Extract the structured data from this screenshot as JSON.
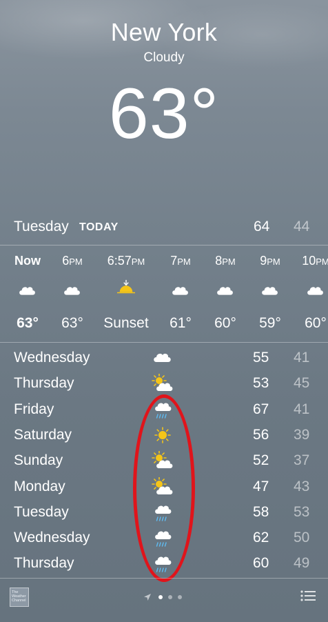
{
  "location": {
    "city": "New York",
    "condition": "Cloudy",
    "temperature": "63°"
  },
  "today": {
    "day": "Tuesday",
    "tag": "TODAY",
    "high": "64",
    "low": "44"
  },
  "hourly": [
    {
      "time": "Now",
      "time_suffix": "",
      "icon": "cloud-icon",
      "temp": "63°"
    },
    {
      "time": "6",
      "time_suffix": "PM",
      "icon": "cloud-icon",
      "temp": "63°"
    },
    {
      "time": "6:57",
      "time_suffix": "PM",
      "icon": "sunset-icon",
      "temp": "Sunset"
    },
    {
      "time": "7",
      "time_suffix": "PM",
      "icon": "cloud-icon",
      "temp": "61°"
    },
    {
      "time": "8",
      "time_suffix": "PM",
      "icon": "cloud-icon",
      "temp": "60°"
    },
    {
      "time": "9",
      "time_suffix": "PM",
      "icon": "cloud-icon",
      "temp": "59°"
    },
    {
      "time": "10",
      "time_suffix": "PM",
      "icon": "cloud-icon",
      "temp": "60°"
    }
  ],
  "daily": [
    {
      "day": "Wednesday",
      "icon": "cloud-icon",
      "high": "55",
      "low": "41"
    },
    {
      "day": "Thursday",
      "icon": "partly-sunny-icon",
      "high": "53",
      "low": "45"
    },
    {
      "day": "Friday",
      "icon": "rain-icon",
      "high": "67",
      "low": "41"
    },
    {
      "day": "Saturday",
      "icon": "sun-icon",
      "high": "56",
      "low": "39"
    },
    {
      "day": "Sunday",
      "icon": "partly-sunny-icon",
      "high": "52",
      "low": "37"
    },
    {
      "day": "Monday",
      "icon": "partly-sunny-icon",
      "high": "47",
      "low": "43"
    },
    {
      "day": "Tuesday",
      "icon": "rain-icon",
      "high": "58",
      "low": "53"
    },
    {
      "day": "Wednesday",
      "icon": "rain-icon",
      "high": "62",
      "low": "50"
    },
    {
      "day": "Thursday",
      "icon": "rain-icon",
      "high": "60",
      "low": "49"
    }
  ],
  "footer": {
    "logo_text": "The Weather Channel",
    "pages": 3,
    "active_page": 1
  },
  "colors": {
    "annotation": "#e0141b",
    "sun": "#f5c518",
    "rain": "#5fb8ec"
  }
}
